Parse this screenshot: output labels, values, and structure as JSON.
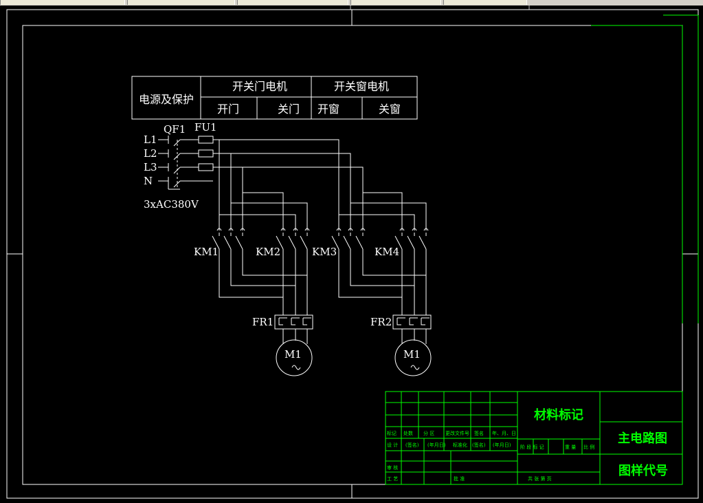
{
  "header_table": {
    "power": "电源及保护",
    "door_motor": "开关门电机",
    "window_motor": "开关窗电机",
    "open_door": "开门",
    "close_door": "关门",
    "open_window": "开窗",
    "close_window": "关窗"
  },
  "supply": {
    "breaker": "QF1",
    "fuse": "FU1",
    "l1": "L1",
    "l2": "L2",
    "l3": "L3",
    "n": "N",
    "voltage": "3xAC380V"
  },
  "contactors": {
    "km1": "KM1",
    "km2": "KM2",
    "km3": "KM3",
    "km4": "KM4"
  },
  "relays": {
    "fr1": "FR1",
    "fr2": "FR2"
  },
  "motors": {
    "m1a": "M1",
    "m1b": "M1"
  },
  "title_block": {
    "material": "材料标记",
    "drawing_name": "主电路图",
    "drawing_code": "图样代号",
    "r_mark": "标记",
    "r_count": "处数",
    "r_zone": "分 区",
    "r_docno": "更改文件号",
    "r_sign": "签名",
    "r_ymd": "年、月、日",
    "r_design": "设 计",
    "r_signname": "(签名)",
    "r_date": "(年月日)",
    "r_standard": "标准化",
    "r_signname2": "(签名)",
    "r_date2": "(年月日)",
    "r_stage": "阶 段 标 记",
    "r_weight": "重 量",
    "r_scale": "比 例",
    "r_review": "审 核",
    "r_craft": "工 艺",
    "r_approve": "批 准",
    "r_sheets": "共   张   第   页"
  },
  "colors": {
    "line": "#ffffff",
    "titleblock": "#00ff00",
    "background": "#000000"
  }
}
